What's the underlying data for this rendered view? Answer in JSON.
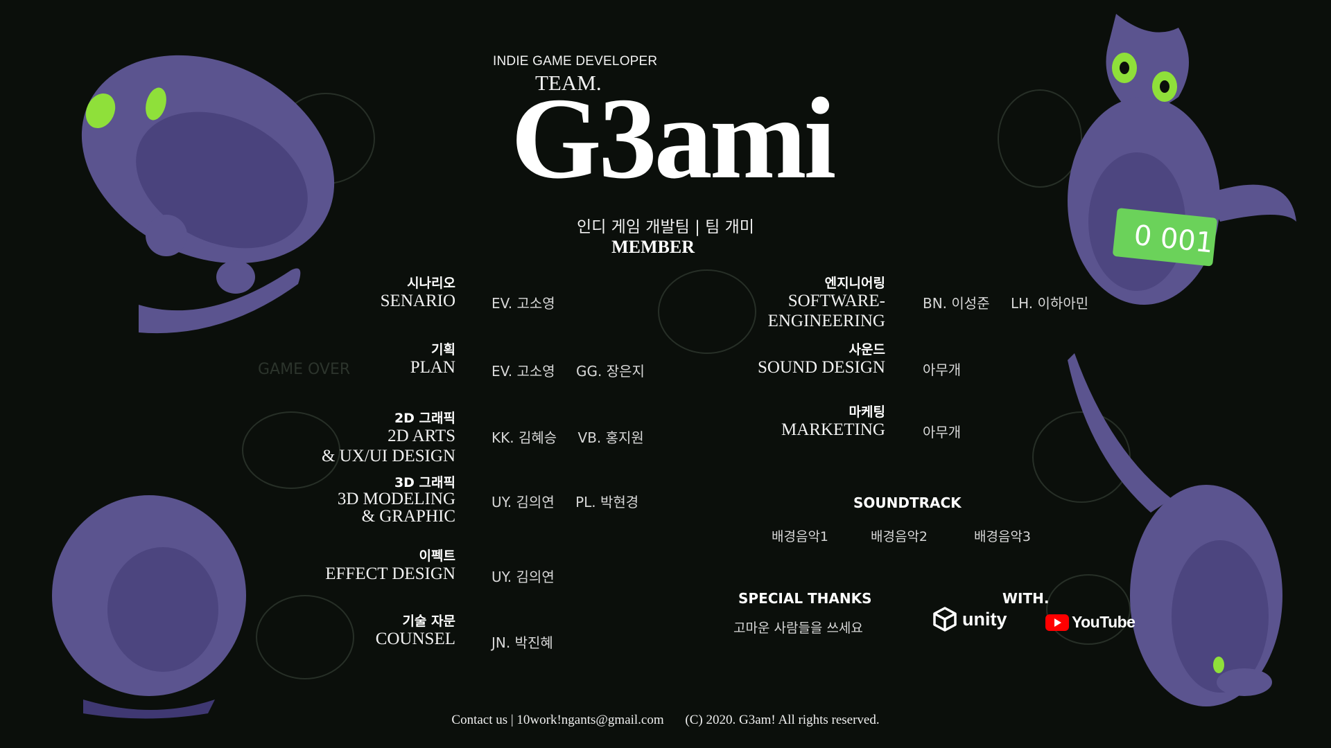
{
  "header": {
    "kicker": "INDIE GAME DEVELOPER",
    "team_label": "TEAM.",
    "logo_text": "G3ami",
    "subtitle": "인디 게임 개발팀 | 팀 개미",
    "member_heading": "MEMBER"
  },
  "roles_left": [
    {
      "ko": "시나리오",
      "en": [
        "SENARIO"
      ],
      "names": [
        "EV. 고소영"
      ]
    },
    {
      "ko": "기획",
      "en": [
        "PLAN"
      ],
      "names": [
        "EV. 고소영",
        "GG. 장은지"
      ]
    },
    {
      "ko": "2D 그래픽",
      "en": [
        "2D ARTS",
        "& UX/UI DESIGN"
      ],
      "names": [
        "KK. 김혜승",
        "VB. 홍지원"
      ]
    },
    {
      "ko": "3D 그래픽",
      "en": [
        "3D MODELING",
        "& GRAPHIC"
      ],
      "names": [
        "UY. 김의연",
        "PL. 박현경"
      ]
    },
    {
      "ko": "이펙트",
      "en": [
        "EFFECT DESIGN"
      ],
      "names": [
        "UY. 김의연"
      ]
    },
    {
      "ko": "기술 자문",
      "en": [
        "COUNSEL"
      ],
      "names": [
        "JN. 박진혜"
      ]
    }
  ],
  "roles_right": [
    {
      "ko": "엔지니어링",
      "en": [
        "SOFTWARE-",
        "ENGINEERING"
      ],
      "names": [
        "BN. 이성준",
        "LH. 이하아민"
      ]
    },
    {
      "ko": "사운드",
      "en": [
        "SOUND DESIGN"
      ],
      "names": [
        "아무개"
      ]
    },
    {
      "ko": "마케팅",
      "en": [
        "MARKETING"
      ],
      "names": [
        "아무개"
      ]
    }
  ],
  "soundtrack": {
    "title": "SOUNDTRACK",
    "tracks": [
      "배경음악1",
      "배경음악2",
      "배경음악3"
    ]
  },
  "special_thanks": {
    "title": "SPECIAL THANKS",
    "text": "고마운 사람들을 쓰세요"
  },
  "with": {
    "title": "WITH.",
    "unity": "unity",
    "youtube": "YouTube"
  },
  "footer": {
    "contact": "Contact us | 10work!ngants@gmail.com",
    "copyright": "(C) 2020. G3am! All rights reserved."
  },
  "colors": {
    "background": "#0b0f0b",
    "cat_body": "#5b548f",
    "cat_shadow": "#3f3872",
    "cat_eyes": "#8fe03a",
    "youtube_red": "#ff0000"
  },
  "icons": [
    "cat-illustration",
    "unity-icon",
    "youtube-play-icon"
  ]
}
